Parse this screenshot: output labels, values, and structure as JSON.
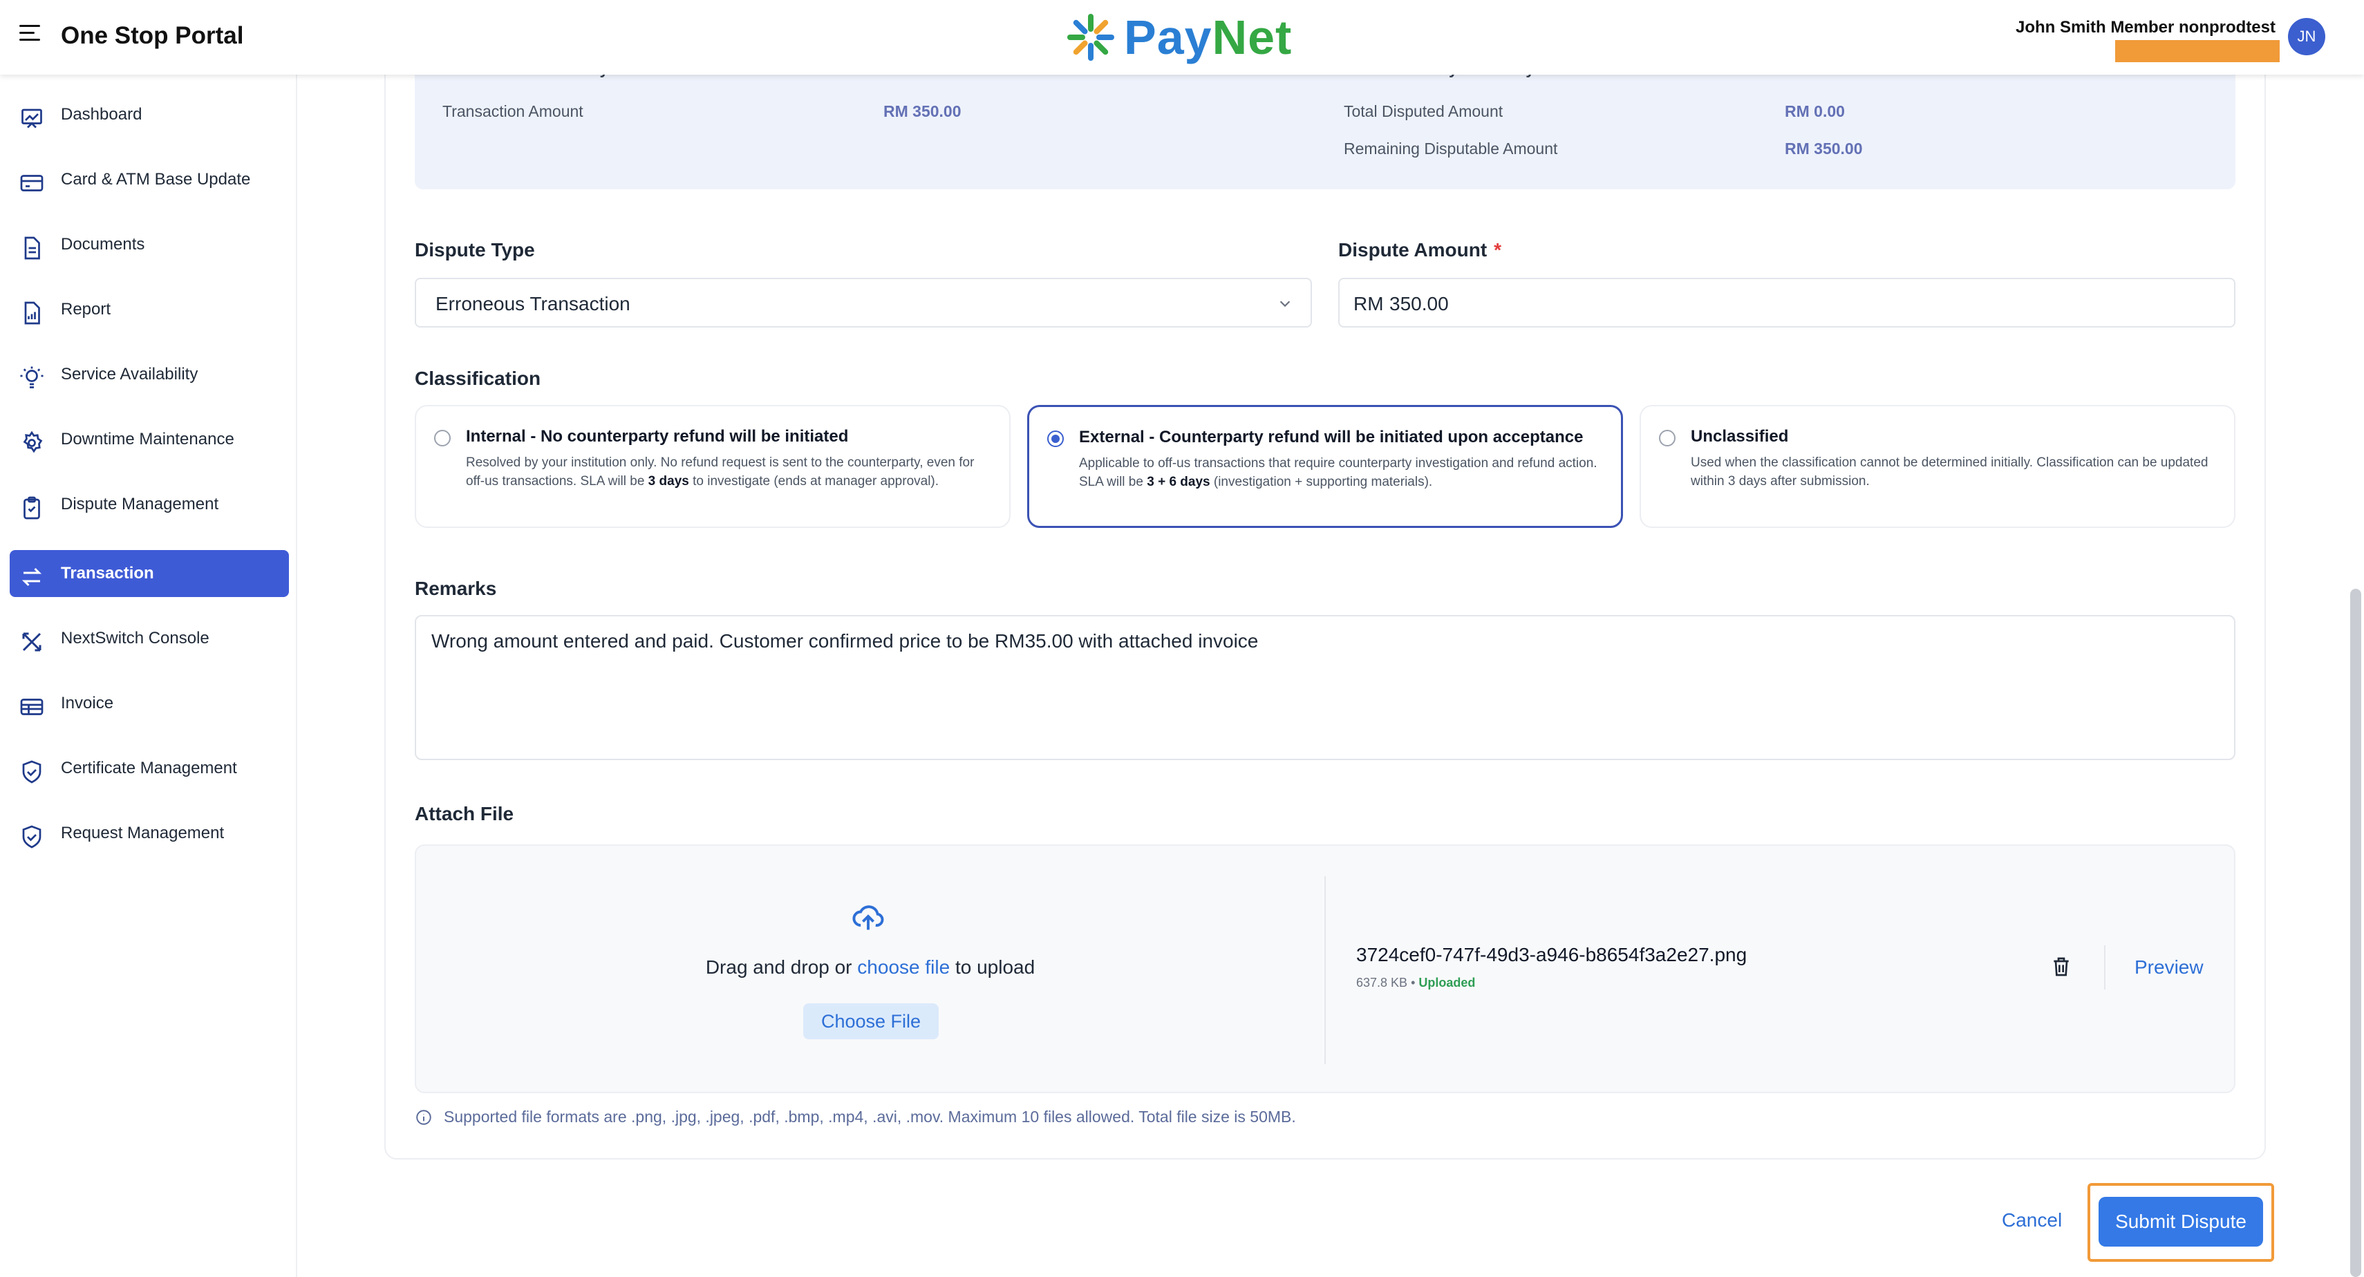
{
  "header": {
    "portal_title": "One Stop Portal",
    "logo_pay": "Pay",
    "logo_net": "Net",
    "user_name": "John Smith Member nonprodtest",
    "avatar_initials": "JN"
  },
  "sidebar": {
    "items": [
      {
        "label": "Dashboard",
        "icon": "chart-icon"
      },
      {
        "label": "Card & ATM Base Update",
        "icon": "card-icon"
      },
      {
        "label": "Documents",
        "icon": "document-icon"
      },
      {
        "label": "Report",
        "icon": "report-icon"
      },
      {
        "label": "Service Availability",
        "icon": "lightbulb-icon"
      },
      {
        "label": "Downtime Maintenance",
        "icon": "gear-icon"
      },
      {
        "label": "Dispute Management",
        "icon": "clipboard-icon"
      },
      {
        "label": "Transaction",
        "icon": "swap-icon",
        "active": true
      },
      {
        "label": "NextSwitch Console",
        "icon": "switch-icon"
      },
      {
        "label": "Invoice",
        "icon": "invoice-icon"
      },
      {
        "label": "Certificate Management",
        "icon": "shield-icon"
      },
      {
        "label": "Request Management",
        "icon": "shield-icon"
      }
    ]
  },
  "summary": {
    "left_header": "Transaction Summary",
    "right_header": "Refund History Summary",
    "transaction_amount_label": "Transaction Amount",
    "transaction_amount_value": "RM 350.00",
    "total_disputed_label": "Total Disputed Amount",
    "total_disputed_value": "RM 0.00",
    "remaining_label": "Remaining Disputable Amount",
    "remaining_value": "RM 350.00"
  },
  "form": {
    "dispute_type_label": "Dispute Type",
    "dispute_type_value": "Erroneous Transaction",
    "dispute_amount_label": "Dispute Amount",
    "required_mark": "*",
    "currency": "RM",
    "dispute_amount_value": "350.00",
    "classification_label": "Classification",
    "classification": {
      "internal": {
        "title": "Internal - No counterparty refund will be initiated",
        "desc_1": "Resolved by your institution only. No refund request is sent to the counterparty, even for off-us transactions. SLA will be ",
        "desc_bold": "3 days",
        "desc_2": " to investigate (ends at manager approval)."
      },
      "external": {
        "title": "External - Counterparty refund will be initiated upon acceptance",
        "desc_1": "Applicable to off-us transactions that require counterparty investigation and refund action. SLA will be ",
        "desc_bold": "3 + 6 days",
        "desc_2": " (investigation + supporting materials)."
      },
      "unclassified": {
        "title": "Unclassified",
        "desc": "Used when the classification cannot be determined initially. Classification can be updated within 3 days after submission."
      }
    },
    "remarks_label": "Remarks",
    "remarks_value": "Wrong amount entered and paid. Customer confirmed price to be RM35.00 with attached invoice",
    "attach_label": "Attach File",
    "drag_prefix": "Drag and drop or ",
    "drag_link": "choose file",
    "drag_suffix": " to upload",
    "choose_button": "Choose File",
    "file_name": "3724cef0-747f-49d3-a946-b8654f3a2e27.png",
    "file_size": "637.8 KB",
    "file_sep": " • ",
    "file_status": "Uploaded",
    "preview_label": "Preview",
    "formats_note": "Supported file formats are .png, .jpg, .jpeg, .pdf, .bmp, .mp4, .avi, .mov. Maximum 10 files allowed. Total file size is 50MB."
  },
  "actions": {
    "cancel": "Cancel",
    "submit": "Submit Dispute"
  },
  "colors": {
    "accent": "#3e5bd6",
    "link": "#2d6fd6",
    "highlight": "#f19a38",
    "success": "#2f9e55"
  }
}
